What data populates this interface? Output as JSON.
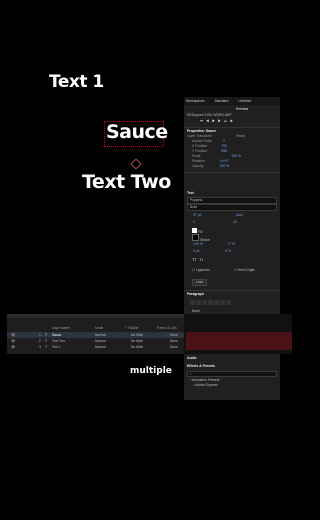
{
  "canvas": {
    "text1": "Text 1",
    "sauce": "Sauce",
    "text2": "Text Two",
    "caption": "multiple"
  },
  "panel": {
    "tabs": [
      "Workspaces",
      "Standard",
      "Libraries"
    ],
    "subtabs": [
      "Preview"
    ],
    "project_name": "DEDuppen 3 BG WORD.AEP",
    "props_title": "Properties: Sauce",
    "layer_transform": "Layer Transform",
    "reset": "Reset",
    "transform": [
      {
        "label": "Anchor Point",
        "value": "0"
      },
      {
        "label": "X Position",
        "value": "702"
      },
      {
        "label": "Y Position",
        "value": "896"
      },
      {
        "label": "Scale",
        "value": "100 %"
      },
      {
        "label": "Rotation",
        "value": "0x+0°"
      },
      {
        "label": "Opacity",
        "value": "100 %"
      }
    ],
    "text_section": "Text",
    "font": "Poppins",
    "style": "Bold",
    "size": "37 px",
    "tracking": "0",
    "auto": "Auto",
    "tracking2": "-10",
    "fill": "Fill",
    "stroke": "Stroke",
    "horiz_scale": "100 %",
    "vert_scale": "77 %",
    "baseline": "0 px",
    "tsume": "0 %",
    "tt": "TT",
    "tt2": "Tᴛ",
    "ligatures": "Ligatures",
    "hindi_digits": "Hindi Digits",
    "less_button": "Less",
    "paragraph": "Paragraph",
    "more_button": "More",
    "text_animation": "Text Animation",
    "add_animator": "Add Animator",
    "align": "Align",
    "audio": "Audio",
    "effects_presets": "Effects & Presets",
    "animation_presets": "Animation Presets",
    "adobe_express": "Adobe Express"
  },
  "timeline": {
    "headers": [
      "Layer Name",
      "Mode",
      "T TrkMat",
      "Parent & Link"
    ],
    "layers": [
      {
        "num": "1",
        "name": "Sauce",
        "mode": "Normal",
        "trk": "No Matt",
        "parent": "None"
      },
      {
        "num": "2",
        "name": "Text Two",
        "mode": "Normal",
        "trk": "No Matt",
        "parent": "None"
      },
      {
        "num": "3",
        "name": "Text 1",
        "mode": "Normal",
        "trk": "No Matt",
        "parent": "None"
      }
    ]
  },
  "colors": {
    "accent_value": "#6fa0e8",
    "selection": "#cc0033",
    "clip_bar": "#4a1216"
  }
}
